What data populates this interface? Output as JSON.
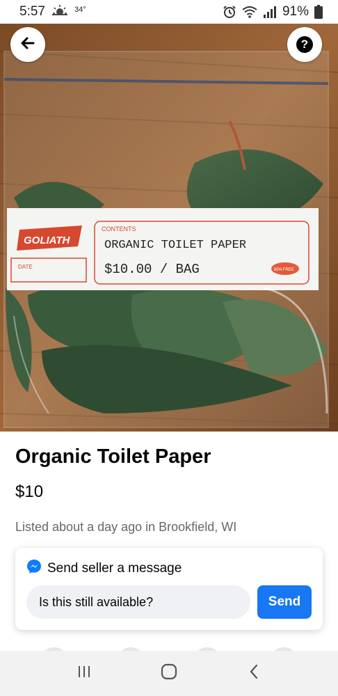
{
  "status_bar": {
    "time": "5:57",
    "temperature": "34°",
    "battery": "91%",
    "icons": [
      "weather-icon",
      "alarm-icon",
      "wifi-icon",
      "signal-icon",
      "battery-icon"
    ]
  },
  "photo": {
    "label_brand": "GOLIATH",
    "label_contents_heading": "CONTENTS",
    "label_line1": "ORGANIC TOILET PAPER",
    "label_line2": "$10.00 / BAG",
    "label_date": "DATE",
    "label_badge": "BPA FREE"
  },
  "listing": {
    "title": "Organic Toilet Paper",
    "price": "$10",
    "listed": "Listed about a day ago in Brookfield, WI"
  },
  "message_card": {
    "header": "Send seller a message",
    "input_value": "Is this still available?",
    "send_label": "Send"
  },
  "colors": {
    "accent": "#1877f2",
    "messenger": "#0a7cff",
    "secondary_text": "#65676b"
  },
  "nav": {
    "icons": [
      "recent-apps-icon",
      "home-icon",
      "back-icon"
    ]
  }
}
